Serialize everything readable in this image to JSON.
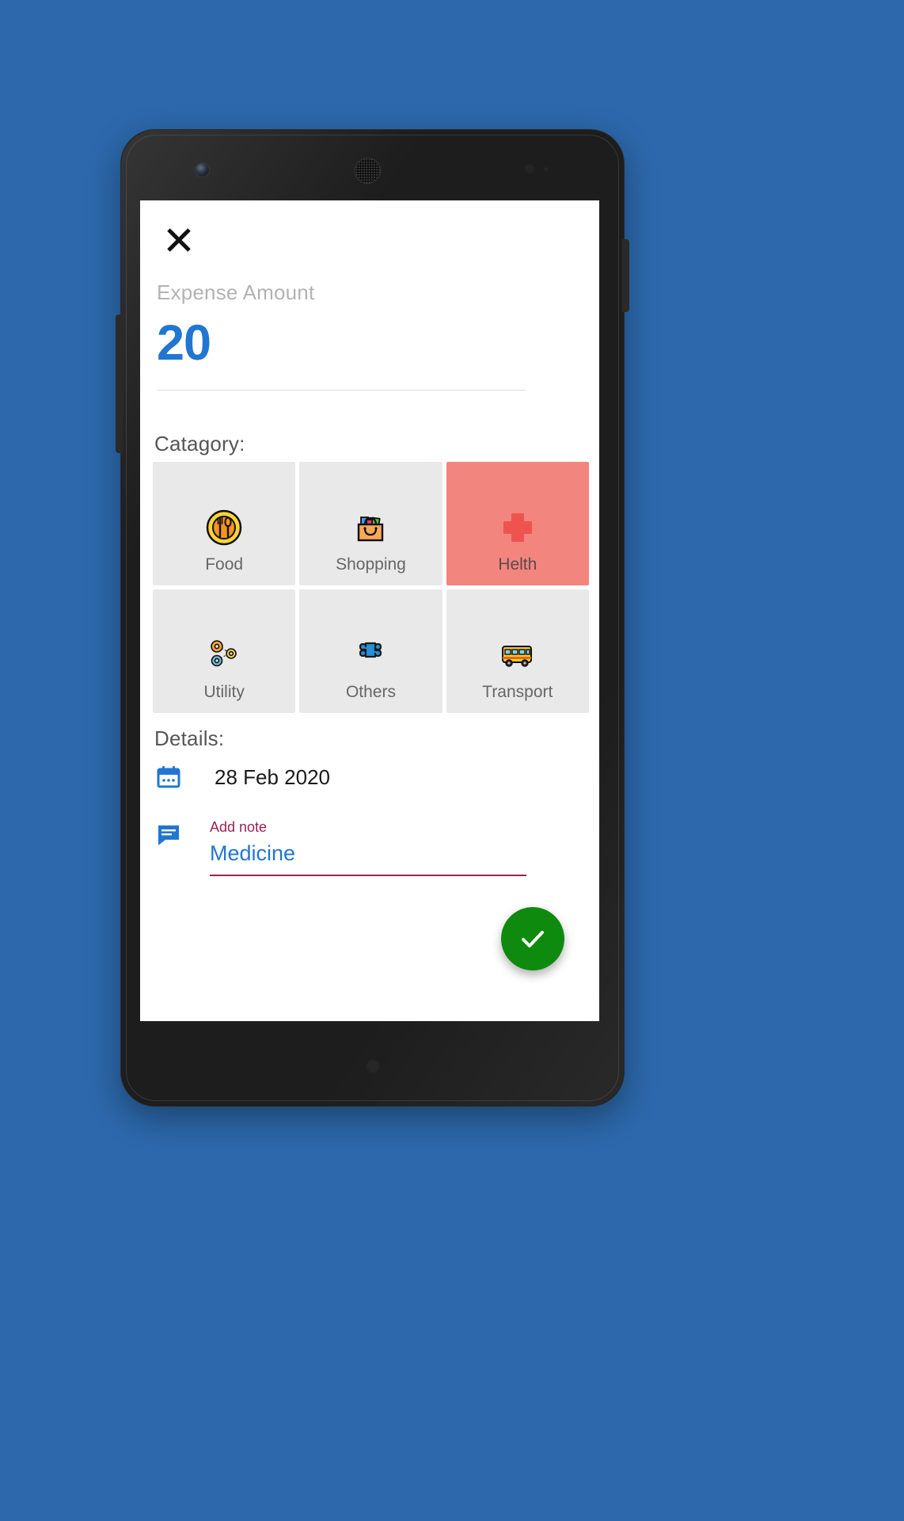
{
  "device": {
    "frame_color": "#1d1d1d",
    "background_color": "#2c68ab"
  },
  "screen": {
    "close_icon": "close-icon",
    "amount": {
      "label": "Expense Amount",
      "value": "20",
      "value_color": "#2176d2",
      "placeholder": "Expense Amount"
    },
    "category": {
      "title": "Catagory:",
      "selected": "Helth",
      "selected_color": "#f3857f",
      "tile_color": "#e9e9e9",
      "items": [
        {
          "label": "Food",
          "icon": "food-plate-icon",
          "selected": false
        },
        {
          "label": "Shopping",
          "icon": "shopping-bag-icon",
          "selected": false
        },
        {
          "label": "Helth",
          "icon": "medical-cross-icon",
          "selected": true
        },
        {
          "label": "Utility",
          "icon": "gears-icon",
          "selected": false
        },
        {
          "label": "Others",
          "icon": "puzzle-piece-icon",
          "selected": false
        },
        {
          "label": "Transport",
          "icon": "school-bus-icon",
          "selected": false
        }
      ]
    },
    "details": {
      "title": "Details:",
      "date": {
        "icon": "calendar-icon",
        "value": "28 Feb 2020"
      },
      "note": {
        "icon": "chat-note-icon",
        "label": "Add note",
        "value": "Medicine",
        "placeholder": "Add note",
        "label_color": "#9c2150",
        "value_color": "#2176d2"
      }
    },
    "save_fab": {
      "icon": "check-icon",
      "color": "#0e8a0e"
    }
  }
}
